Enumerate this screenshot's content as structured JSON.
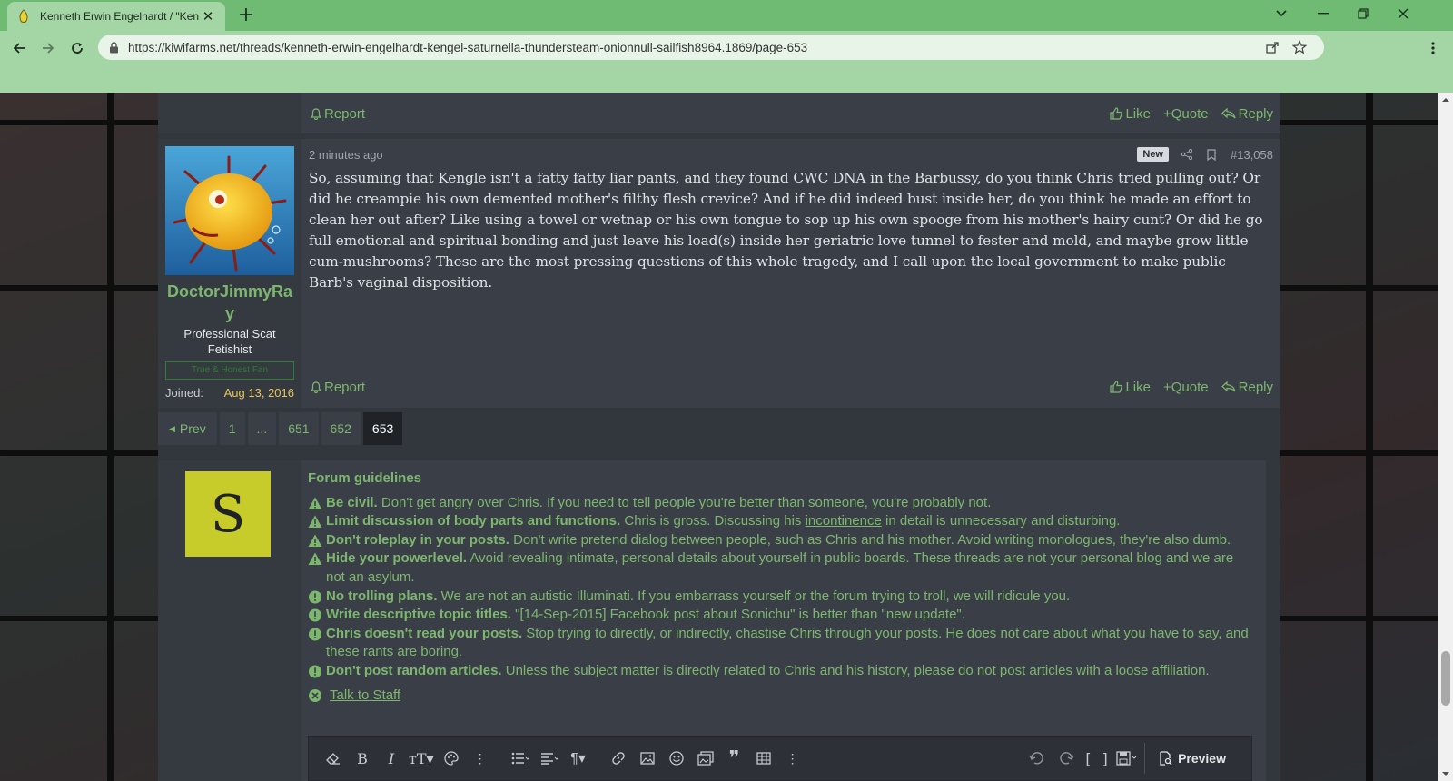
{
  "browser": {
    "tab_title": "Kenneth Erwin Engelhardt / \"Ken",
    "url": "https://kiwifarms.net/threads/kenneth-erwin-engelhardt-kengel-saturnella-thundersteam-onionnull-sailfish8964.1869/page-653"
  },
  "post_prev": {
    "report_label": "Report",
    "like_label": "Like",
    "quote_label": "Quote",
    "reply_label": "Reply"
  },
  "post": {
    "time": "2 minutes ago",
    "badge": "New",
    "number": "#13,058",
    "message": "So, assuming that Kengle isn't a fatty fatty liar pants, and they found CWC DNA in the Barbussy, do you think Chris tried pulling out? Or did he creampie his own demented mother's filthy flesh crevice? And if he did indeed bust inside her, do you think he made an effort to clean her out after? Like using a towel or wetnap or his own tongue to sop up his own spooge from his mother's hairy cunt? Or did he go full emotional and spiritual bonding and just leave his load(s) inside her geriatric love tunnel to fester and mold, and maybe grow little cum-mushrooms? These are the most pressing questions of this whole tragedy, and I call upon the local government to make public Barb's vaginal disposition.",
    "username": "DoctorJimmyRay",
    "user_title": "Professional Scat Fetishist",
    "banner": "True & Honest Fan",
    "joined_label": "Joined:",
    "joined_date": "Aug 13, 2016",
    "report_label": "Report",
    "like_label": "Like",
    "quote_label": "Quote",
    "reply_label": "Reply"
  },
  "pagination": {
    "prev": "Prev",
    "pages": [
      "1",
      "...",
      "651",
      "652",
      "653"
    ],
    "current": "653"
  },
  "guidelines": {
    "avatar_letter": "S",
    "title": "Forum guidelines",
    "rules": [
      {
        "icon": "warning-icon",
        "bold": "Be civil.",
        "text": " Don't get angry over Chris. If you need to tell people you're better than someone, you're probably not."
      },
      {
        "icon": "warning-icon",
        "bold": "Limit discussion of body parts and functions.",
        "text_before": " Chris is gross. Discussing his ",
        "link": "incontinence",
        "text_after": " in detail is unnecessary and disturbing."
      },
      {
        "icon": "warning-icon",
        "bold": "Don't roleplay in your posts.",
        "text": " Don't write pretend dialog between people, such as Chris and his mother. Avoid writing monologues, they're also dumb."
      },
      {
        "icon": "warning-icon",
        "bold": "Hide your powerlevel.",
        "text": " Avoid revealing intimate, personal details about yourself in public boards. These threads are not your personal blog and we are not an asylum."
      },
      {
        "icon": "info-icon",
        "bold": "No trolling plans.",
        "text": " We are not an autistic Illuminati. If you embarrass yourself or the forum trying to troll, we will ridicule you."
      },
      {
        "icon": "info-icon",
        "bold": "Write descriptive topic titles.",
        "text": " \"[14-Sep-2015] Facebook post about Sonichu\" is better than \"new update\"."
      },
      {
        "icon": "info-icon",
        "bold": "Chris doesn't read your posts.",
        "text": " Stop trying to directly, or indirectly, chastise Chris through your posts. He does not care about what you have to say, and these rants are boring."
      },
      {
        "icon": "info-icon",
        "bold": "Don't post random articles.",
        "text": " Unless the subject matter is directly related to Chris and his history, please do not post articles with a loose affiliation."
      }
    ],
    "talk_to_staff": "Talk to Staff"
  },
  "editor": {
    "preview_label": "Preview"
  },
  "colors": {
    "accent": "#7db66f",
    "chrome": "#6fbb73",
    "post_bg": "#3a3f47"
  }
}
